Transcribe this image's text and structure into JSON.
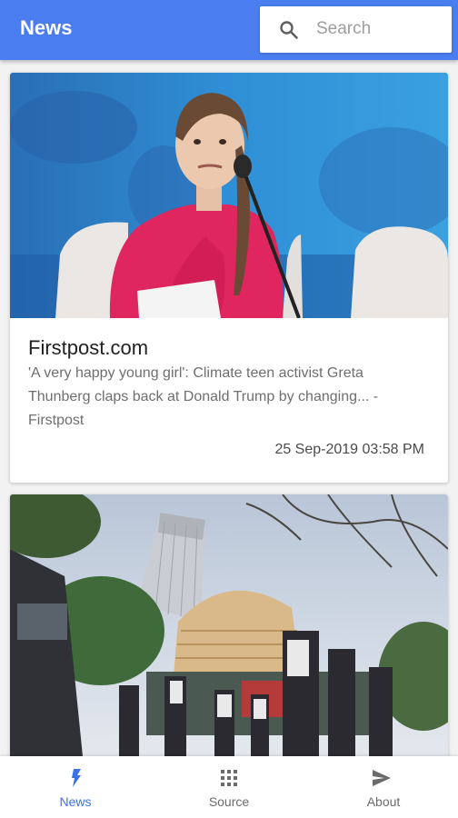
{
  "appbar": {
    "title": "News",
    "search_placeholder": "Search",
    "search_value": ""
  },
  "feed": {
    "articles": [
      {
        "source": "Firstpost.com",
        "headline": "'A very happy young girl': Climate teen activist Greta Thunberg claps back at Donald Trump by changing... - Firstpost",
        "date": "25 Sep-2019 03:58 PM",
        "image": "photo of a teen climate activist in pink speaking at a microphone on a blue stage"
      },
      {
        "image": "photo of a stock exchange tower with pedestrians in front"
      }
    ]
  },
  "bottom_nav": {
    "items": [
      {
        "label": "News",
        "icon": "bolt-icon",
        "active": true
      },
      {
        "label": "Source",
        "icon": "grid-icon",
        "active": false
      },
      {
        "label": "About",
        "icon": "send-icon",
        "active": false
      }
    ]
  },
  "colors": {
    "primary": "#4a7df0",
    "active_nav": "#3b72e8",
    "inactive_nav": "#6b6b6b"
  }
}
